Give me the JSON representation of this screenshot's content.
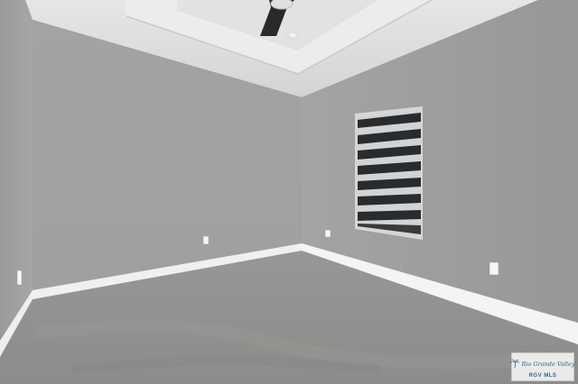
{
  "scene": {
    "description_type": "photo",
    "colors": {
      "wall_left": "#a2a2a0",
      "wall_back": "#9c9c9a",
      "wall_right": "#9a9a98",
      "ceiling": "#dcdcdb",
      "floor": "#8f8f8d",
      "baseboard": "#f2f2f2",
      "window_frame": "#cfcfcf",
      "blind_dark": "#2b2b2b",
      "blind_light": "#cfd4d8"
    }
  },
  "watermark": {
    "line1": "Rio Grande Valley",
    "line2": "RGV MLS",
    "icon": "palm-tree-icon"
  }
}
